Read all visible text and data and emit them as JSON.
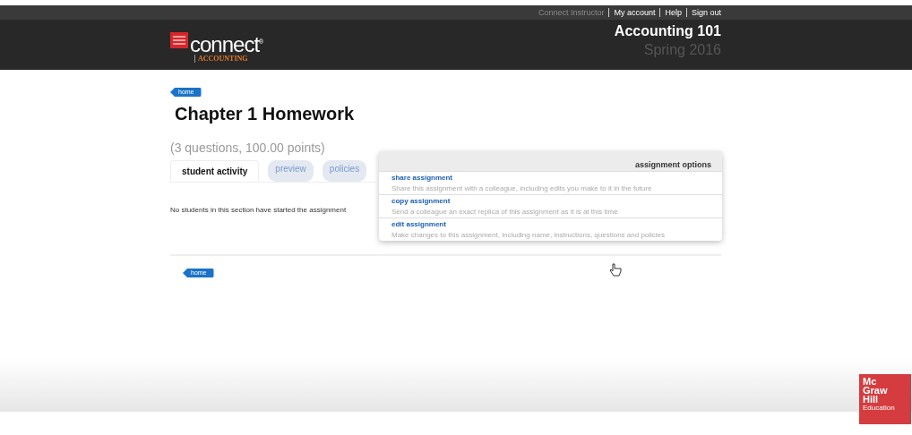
{
  "top_links": [
    {
      "label": "Connect Instructor",
      "disabled": true
    },
    {
      "label": "My account",
      "disabled": false
    },
    {
      "label": "Help",
      "disabled": false
    },
    {
      "label": "Sign out",
      "disabled": false
    }
  ],
  "logo": {
    "name": "connect",
    "mark": "®",
    "subject": "ACCOUNTING"
  },
  "course": {
    "title": "Accounting 101",
    "term": "Spring 2016"
  },
  "home_top": "home",
  "title": "Chapter 1 Homework",
  "summary": "(3 questions, 100.00 points)",
  "tabs": [
    {
      "label": "student activity",
      "selected": true
    },
    {
      "label": "preview",
      "selected": false
    },
    {
      "label": "policies",
      "selected": false
    }
  ],
  "message": "No students in this section have started the assignment",
  "home_bottom": "home",
  "options_menu": {
    "title": "assignment options",
    "items": [
      {
        "label": "share assignment",
        "description": "Share this assignment with a colleague, including edits you make to it in the future"
      },
      {
        "label": "copy assignment",
        "description": "Send a colleague an exact replica of this assignment as it is at this time"
      },
      {
        "label": "edit assignment",
        "description": "Make changes to this assignment, including name, instructions, questions and policies"
      }
    ]
  },
  "brand_badge": [
    "Mc",
    "Graw",
    "Hill",
    "Education"
  ]
}
